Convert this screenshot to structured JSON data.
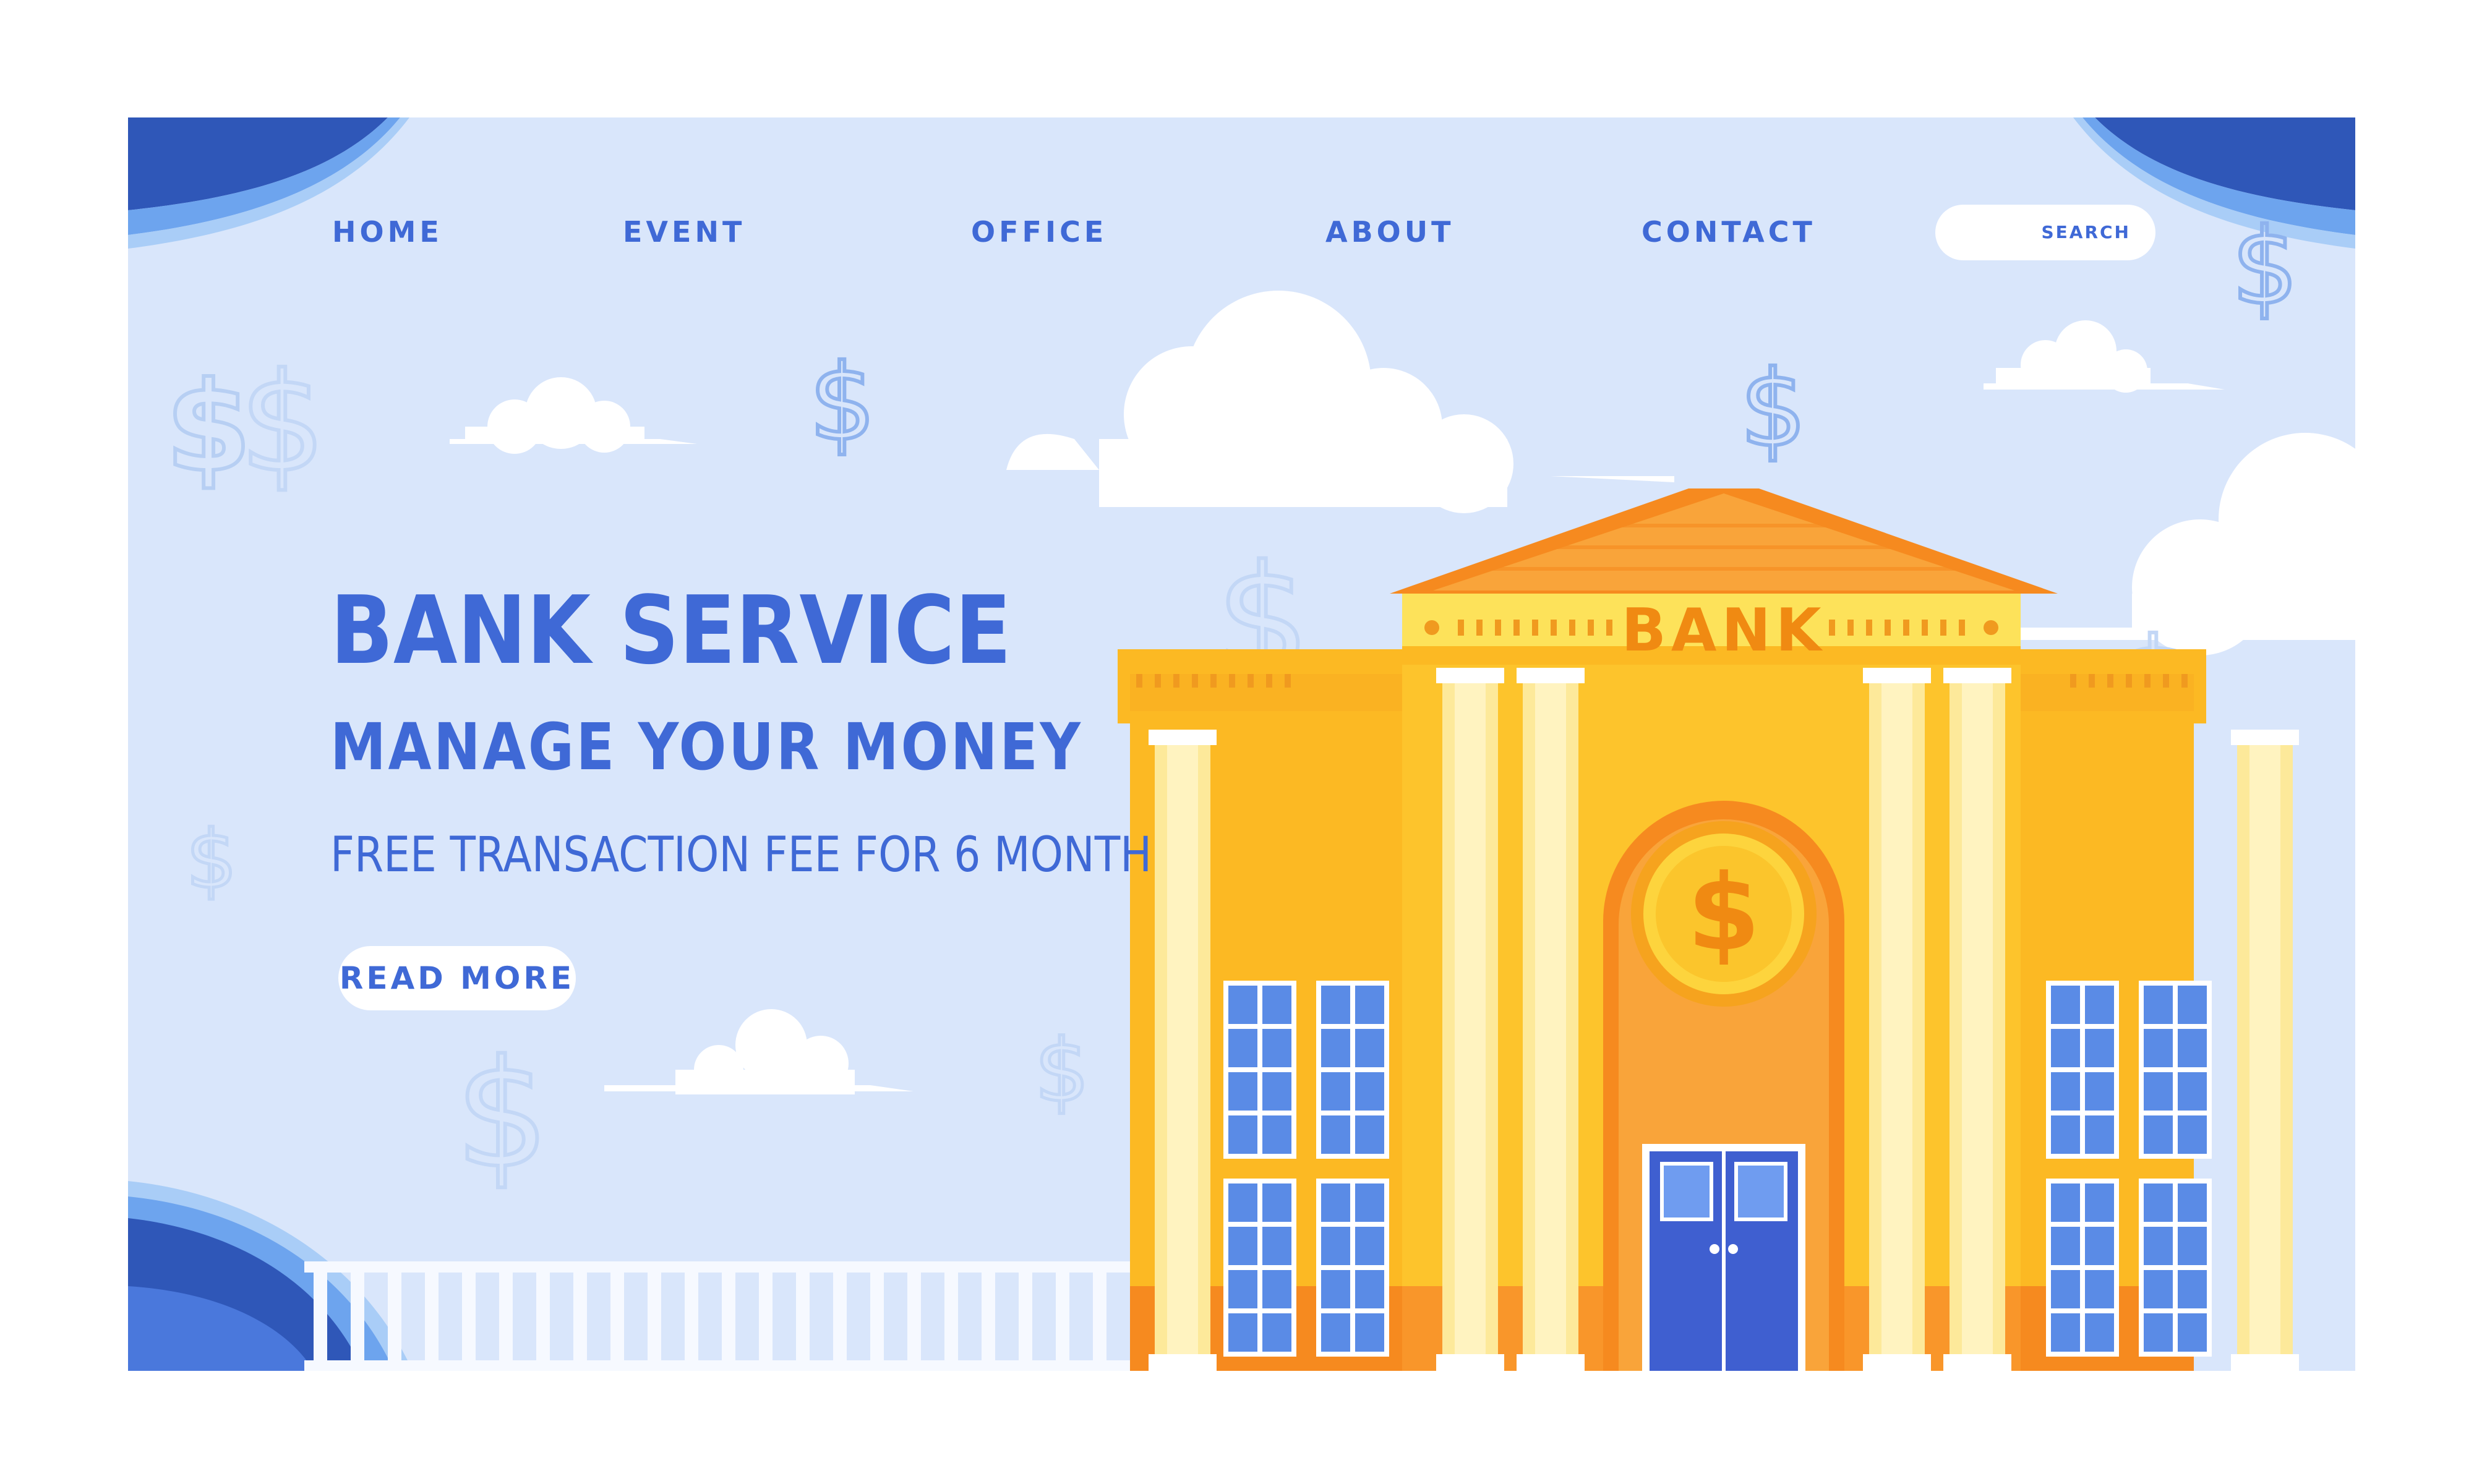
{
  "nav": {
    "items": [
      {
        "label": "HOME"
      },
      {
        "label": "EVENT"
      },
      {
        "label": "OFFICE"
      },
      {
        "label": "ABOUT"
      },
      {
        "label": "CONTACT"
      }
    ],
    "search": {
      "label": "SEARCH",
      "value": ""
    }
  },
  "hero": {
    "title": "BANK SERVICE",
    "subtitle": "MANAGE YOUR MONEY",
    "offer": "FREE TRANSACTION FEE FOR 6 MONTH",
    "cta_label": "READ MORE"
  },
  "illustration": {
    "sign_text": "BANK",
    "coin_symbol": "$",
    "decor_symbol": "$"
  },
  "colors": {
    "background": "#d9e6fb",
    "accent_blue": "#3f69d6",
    "building_yellow": "#fcb923",
    "building_orange": "#f68a1f",
    "wave_blue": "#3f69d6"
  },
  "icons": [
    "dollar-sign-icon",
    "cloud-icon",
    "bank-building-icon",
    "coin-icon",
    "wave-decoration"
  ]
}
